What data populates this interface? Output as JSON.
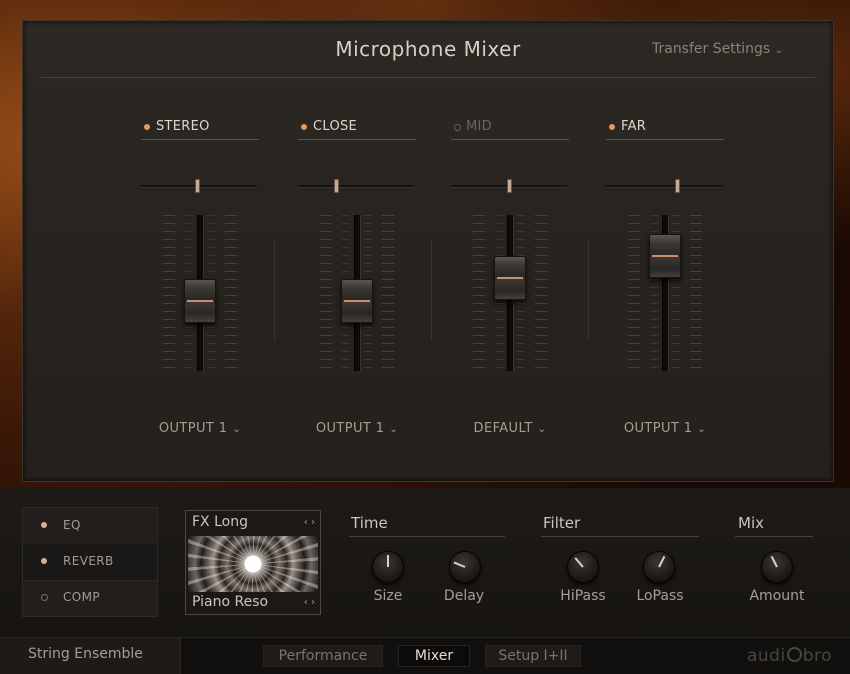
{
  "app": {
    "title": "Microphone Mixer",
    "transfer_label": "Transfer Settings",
    "brand_left": "audi",
    "brand_right": "bro"
  },
  "channels": [
    {
      "name": "STEREO",
      "enabled": true,
      "output": "OUTPUT 1",
      "pan": -0.05,
      "fader_level": 0.44
    },
    {
      "name": "CLOSE",
      "enabled": true,
      "output": "OUTPUT 1",
      "pan": -0.4,
      "fader_level": 0.44
    },
    {
      "name": "MID",
      "enabled": false,
      "output": "DEFAULT",
      "pan": 0.0,
      "fader_level": 0.64
    },
    {
      "name": "FAR",
      "enabled": true,
      "output": "OUTPUT 1",
      "pan": 0.25,
      "fader_level": 0.83
    }
  ],
  "effects": {
    "items": [
      {
        "label": "EQ",
        "enabled": true
      },
      {
        "label": "REVERB",
        "enabled": true
      },
      {
        "label": "COMP",
        "enabled": false
      }
    ],
    "ir_top": "FX Long",
    "ir_bottom": "Piano Reso",
    "ir_arrows": "‹ ›"
  },
  "groups": {
    "time": {
      "title": "Time",
      "size_label": "Size",
      "delay_label": "Delay"
    },
    "filter": {
      "title": "Filter",
      "hipass_label": "HiPass",
      "lopass_label": "LoPass"
    },
    "mix": {
      "title": "Mix",
      "amount_label": "Amount"
    }
  },
  "knob_values": {
    "size": 0.5,
    "delay": 0.25,
    "hipass": 0.35,
    "lopass": 0.6,
    "amount": 0.4
  },
  "footer": {
    "instrument": "String Ensemble",
    "tabs": [
      "Performance",
      "Mixer",
      "Setup I+II"
    ],
    "active_tab": "Mixer"
  },
  "colors": {
    "accent": "#e89a5a",
    "text": "#c9bdb0",
    "panel": "#27231f"
  },
  "icons": {
    "transfer_chevron": "chevron-down-icon",
    "output_chevron": "chevron-down-icon",
    "ir_nav": "left-right-arrows-icon"
  }
}
